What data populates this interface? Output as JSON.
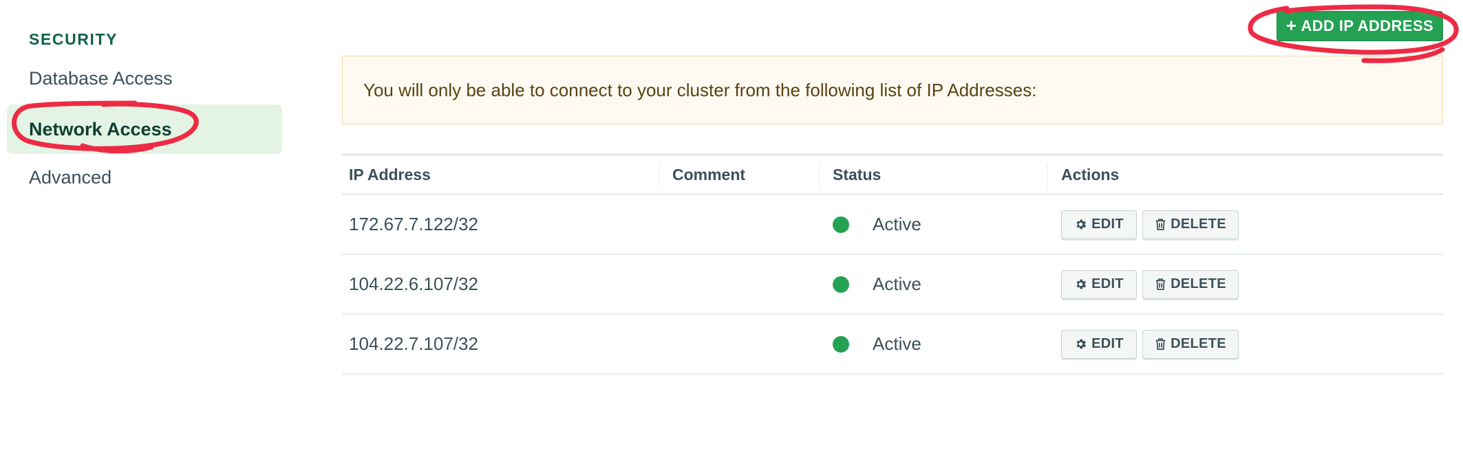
{
  "sidebar": {
    "heading": "SECURITY",
    "items": [
      {
        "label": "Database Access",
        "active": false
      },
      {
        "label": "Network Access",
        "active": true
      },
      {
        "label": "Advanced",
        "active": false
      }
    ]
  },
  "toolbar": {
    "add_ip_label": "ADD IP ADDRESS",
    "add_ip_icon": "plus-icon"
  },
  "banner": {
    "text": "You will only be able to connect to your cluster from the following list of IP Addresses:"
  },
  "table": {
    "headers": [
      "IP Address",
      "Comment",
      "Status",
      "Actions"
    ],
    "rows": [
      {
        "ip": "172.67.7.122/32",
        "comment": "",
        "status": "Active",
        "edit": "EDIT",
        "delete": "DELETE"
      },
      {
        "ip": "104.22.6.107/32",
        "comment": "",
        "status": "Active",
        "edit": "EDIT",
        "delete": "DELETE"
      },
      {
        "ip": "104.22.7.107/32",
        "comment": "",
        "status": "Active",
        "edit": "EDIT",
        "delete": "DELETE"
      }
    ]
  },
  "colors": {
    "accent_green": "#24a153",
    "active_nav_bg": "#e4f4e4",
    "banner_bg": "#fefaf2",
    "annotation_red": "#ee2b44"
  }
}
